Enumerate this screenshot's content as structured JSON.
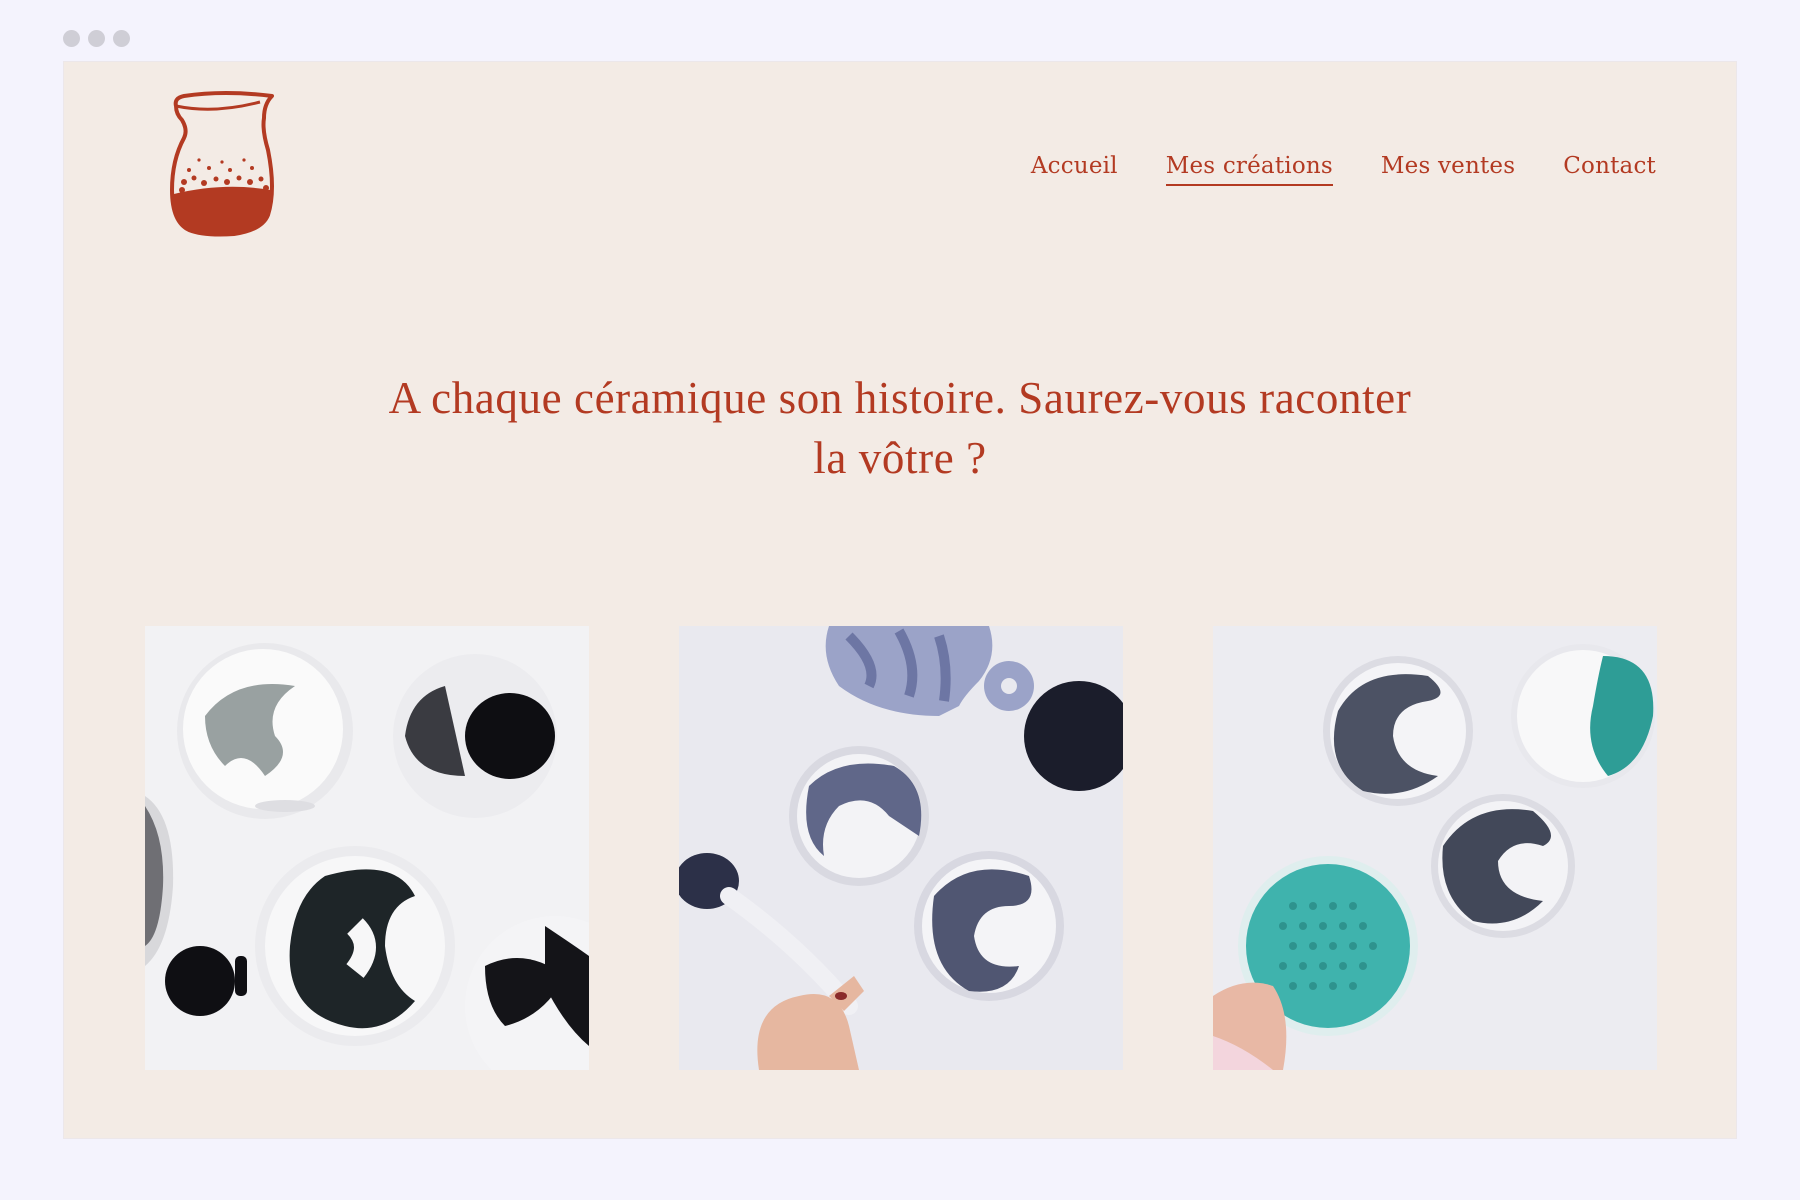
{
  "window": {
    "controls": [
      "close-dot",
      "minimize-dot",
      "maximize-dot"
    ]
  },
  "brand": {
    "logo": "ceramic-vase-logo",
    "color": "#b33a22"
  },
  "nav": {
    "items": [
      {
        "label": "Accueil",
        "active": false
      },
      {
        "label": "Mes créations",
        "active": true
      },
      {
        "label": "Mes ventes",
        "active": false
      },
      {
        "label": "Contact",
        "active": false
      }
    ]
  },
  "hero": {
    "line1": "A chaque céramique son histoire. Saurez-vous raconter",
    "line2": "la vôtre ?"
  },
  "gallery": {
    "photos": [
      {
        "name": "ceramics-photo-1"
      },
      {
        "name": "ceramics-photo-2"
      },
      {
        "name": "ceramics-photo-3"
      }
    ]
  },
  "colors": {
    "page_bg": "#f3ebe5",
    "accent": "#b33a22",
    "outer_bg": "#f4f3fd"
  }
}
